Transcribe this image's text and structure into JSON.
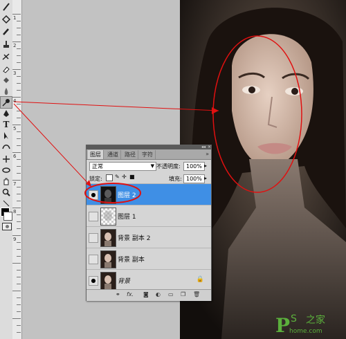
{
  "panel": {
    "tabs": [
      "图层",
      "通道",
      "路径",
      "字符"
    ],
    "blend_mode": "正常",
    "opacity_label": "不透明度:",
    "opacity_value": "100%",
    "lock_label": "锁定:",
    "fill_label": "填充:",
    "fill_value": "100%",
    "menu_icon": "»",
    "bottom_fx": "fx."
  },
  "layers": [
    {
      "name": "图层 2",
      "selected": true,
      "visible": true
    },
    {
      "name": "图层 1",
      "selected": false,
      "visible": false
    },
    {
      "name": "背景 副本 2",
      "selected": false,
      "visible": false
    },
    {
      "name": "背景 副本",
      "selected": false,
      "visible": false
    },
    {
      "name": "背景",
      "selected": false,
      "visible": true,
      "locked": true
    }
  ],
  "ruler_numbers": [
    "1",
    "2",
    "3",
    "4",
    "5",
    "6",
    "7",
    "8",
    "9"
  ],
  "toolbar_icons": [
    "brush-icon",
    "eraser-icon",
    "stamp-icon",
    "history-brush-icon",
    "eraser2-icon",
    "gradient-icon",
    "dodge-icon",
    "burn-icon",
    "pen-icon",
    "type-icon",
    "path-select-icon",
    "shape-icon",
    "notes-icon",
    "eyedropper-icon",
    "hand-icon",
    "zoom-icon"
  ],
  "watermark": {
    "logo_p": "P",
    "logo_s": "S",
    "logo_cn": "之家",
    "url": "home.com"
  },
  "colors": {
    "selection": "#3f8fe5",
    "annotation": "#e01010",
    "watermark": "#5bb03c"
  }
}
